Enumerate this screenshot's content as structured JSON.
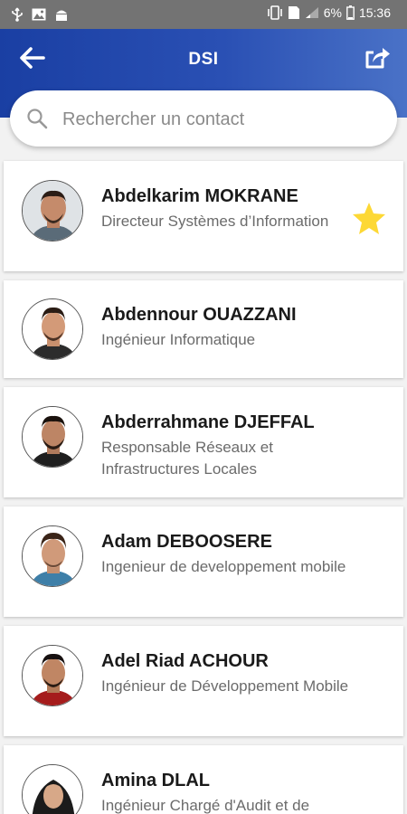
{
  "status_bar": {
    "battery_percent": "6%",
    "time": "15:36",
    "icons": [
      "usb-icon",
      "image-icon",
      "android-icon",
      "vibrate-icon",
      "sim-icon",
      "signal-icon",
      "battery-icon"
    ]
  },
  "header": {
    "title": "DSI",
    "back_icon": "arrow-left-icon",
    "share_icon": "share-icon",
    "background": "#2a50b4"
  },
  "search": {
    "placeholder": "Rechercher un contact",
    "value": "",
    "icon": "search-icon"
  },
  "accent": {
    "star": "#fdd835"
  },
  "contacts": [
    {
      "name": "Abdelkarim MOKRANE",
      "role": "Directeur Systèmes d’Information",
      "favorite": true
    },
    {
      "name": "Abdennour OUAZZANI",
      "role": "Ingénieur Informatique",
      "favorite": false
    },
    {
      "name": "Abderrahmane DJEFFAL",
      "role": "Responsable Réseaux et Infrastructures Locales",
      "favorite": false
    },
    {
      "name": "Adam DEBOOSERE",
      "role": "Ingenieur de developpement mobile",
      "favorite": false
    },
    {
      "name": "Adel Riad ACHOUR",
      "role": "Ingénieur de Développement Mobile",
      "favorite": false
    },
    {
      "name": "Amina DLAL",
      "role": "Ingénieur Chargé d'Audit et de",
      "favorite": false
    }
  ]
}
